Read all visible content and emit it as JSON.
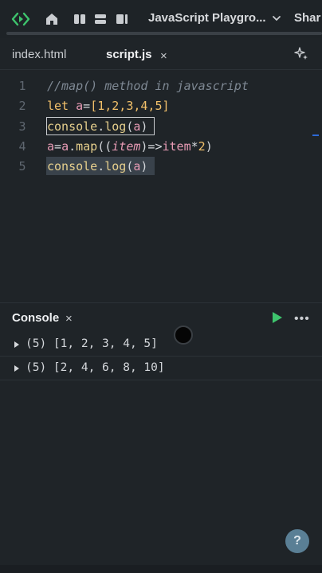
{
  "topbar": {
    "title": "JavaScript Playgro...",
    "share_label": "Shar"
  },
  "tabs": [
    {
      "label": "index.html",
      "active": false
    },
    {
      "label": "script.js",
      "active": true
    }
  ],
  "tab_close_glyph": "×",
  "editor": {
    "lines": [
      {
        "number": "1",
        "text": "//map() method in javascript"
      },
      {
        "number": "2",
        "text": "let a=[1,2,3,4,5]"
      },
      {
        "number": "3",
        "text": "console.log(a)"
      },
      {
        "number": "4",
        "text": "a=a.map((item)=>item*2)"
      },
      {
        "number": "5",
        "text": "console.log(a)"
      }
    ]
  },
  "console": {
    "title": "Console",
    "close_glyph": "×",
    "more_glyph": "•••",
    "rows": [
      {
        "text": "(5) [1, 2, 3, 4, 5]"
      },
      {
        "text": "(5) [2, 4, 6, 8, 10]"
      }
    ]
  },
  "help_label": "?",
  "colors": {
    "background": "#1f2428",
    "accent_green": "#3ec46d",
    "keyword": "#f2c06a",
    "variable": "#e89bb5",
    "help_button": "#5a7f95"
  },
  "icons": [
    "logo-icon",
    "home-icon",
    "layout-split-icon",
    "layout-rows-icon",
    "layout-panel-icon",
    "chevron-down-icon",
    "magic-wand-icon",
    "play-icon",
    "more-icon",
    "expand-triangle-icon"
  ]
}
